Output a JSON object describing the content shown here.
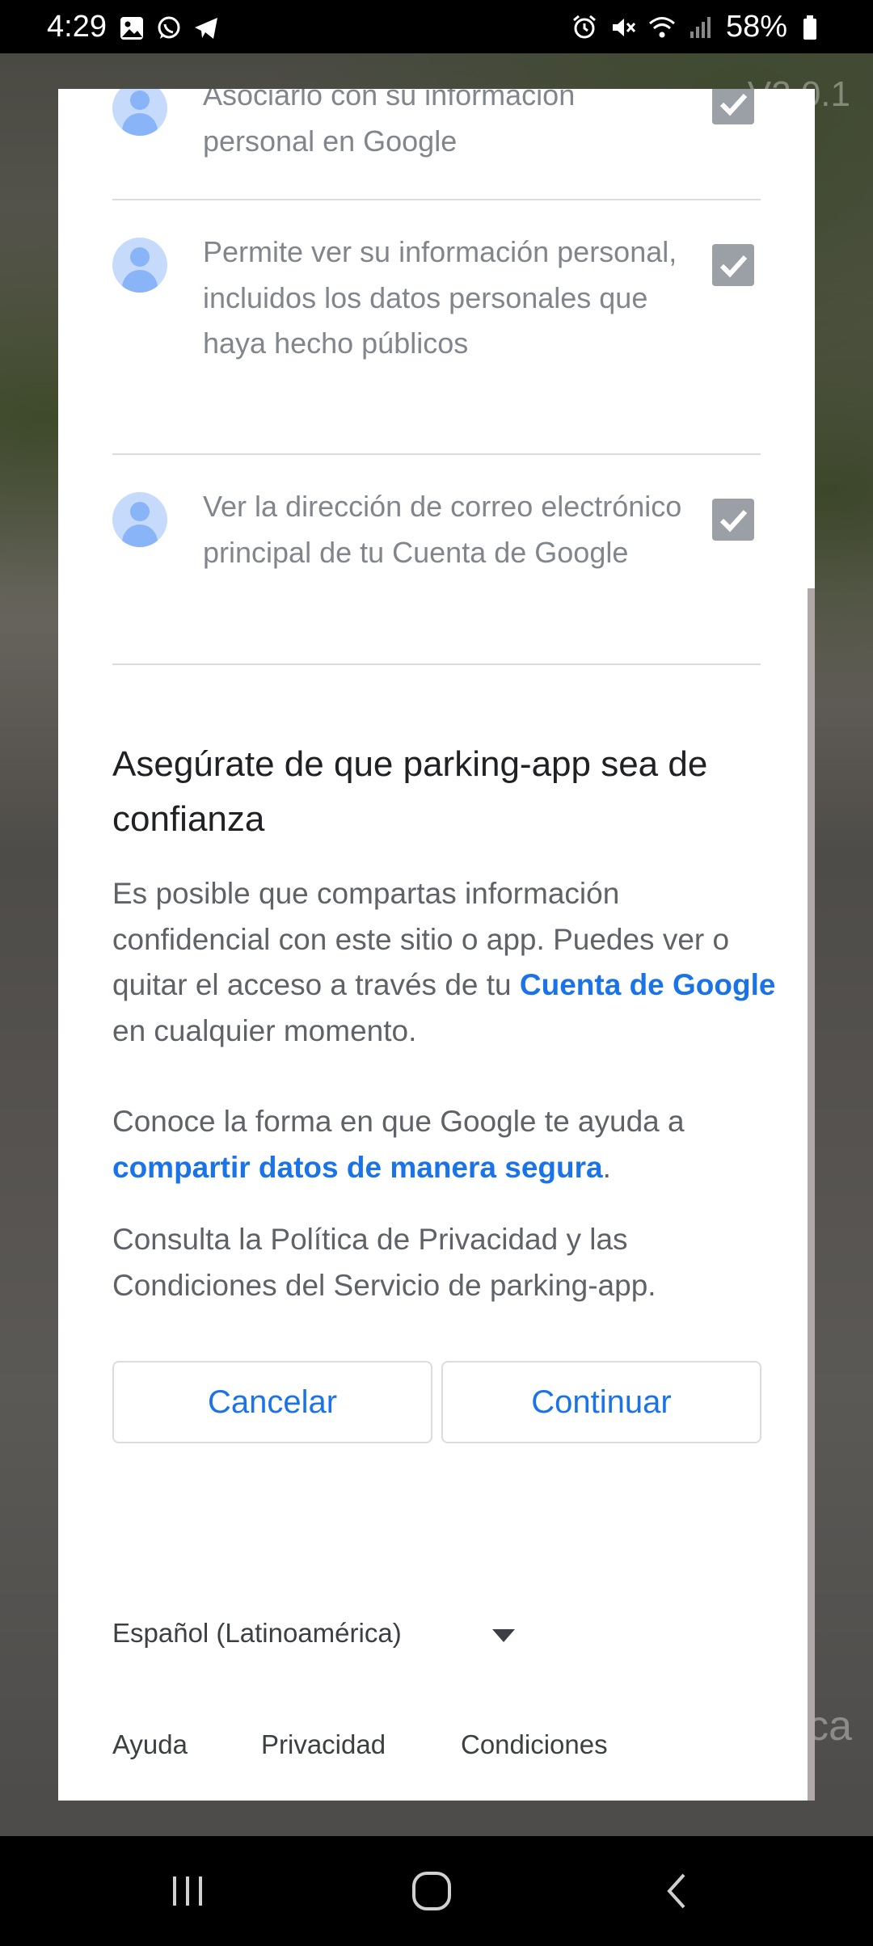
{
  "status_bar": {
    "time": "4:29",
    "battery": "58%",
    "left_icons": [
      "gallery-icon",
      "whatsapp-icon",
      "telegram-icon"
    ],
    "right_icons": [
      "alarm-icon",
      "mute-icon",
      "wifi-icon",
      "signal-icon",
      "battery-icon"
    ]
  },
  "background_app": {
    "version_text": "V2.0.1",
    "bottom_text": "ca"
  },
  "permissions": [
    {
      "text": "Asociarlo con su información personal en Google",
      "checked": true
    },
    {
      "text": "Permite ver su información personal, incluidos los datos personales que haya hecho públicos",
      "checked": true
    },
    {
      "text": "Ver la dirección de correo electrónico principal de tu Cuenta de Google",
      "checked": true
    }
  ],
  "trust": {
    "title": "Asegúrate de que parking-app sea de confianza",
    "para1_prefix": "Es posible que compartas información confidencial con este sitio o app. Puedes ver o quitar el acceso a través de tu ",
    "para1_link": "Cuenta de Google",
    "para1_suffix": " en cualquier momento.",
    "para2_prefix": "Conoce la forma en que Google te ayuda a ",
    "para2_link": "compartir datos de manera segura",
    "para2_suffix": ".",
    "para3": "Consulta la Política de Privacidad y las Condiciones del Servicio de parking-app."
  },
  "buttons": {
    "cancel": "Cancelar",
    "continue": "Continuar"
  },
  "footer": {
    "language": "Español (Latinoamérica)",
    "help": "Ayuda",
    "privacy": "Privacidad",
    "terms": "Condiciones"
  },
  "colors": {
    "link": "#1a73e8",
    "checkbox": "#9aa0a6",
    "avatar_bg": "#c6dafc"
  }
}
